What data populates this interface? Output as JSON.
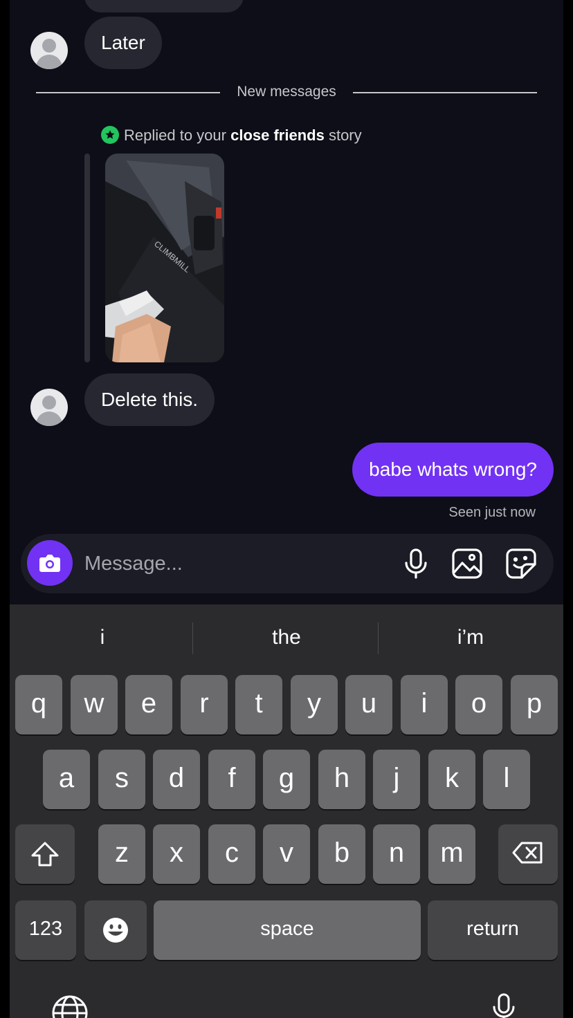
{
  "thread": {
    "messages": [
      {
        "text": "Later",
        "direction": "incoming"
      },
      {
        "text": "Delete this.",
        "direction": "incoming"
      },
      {
        "text": "babe whats wrong?",
        "direction": "outgoing"
      }
    ],
    "new_messages_label": "New messages",
    "story_reply": {
      "prefix": "Replied to your",
      "bold": "close friends",
      "suffix": "story",
      "badge_icon": "star-icon"
    },
    "seen_status": "Seen just now"
  },
  "composer": {
    "placeholder": "Message...",
    "icons": [
      "camera-icon",
      "microphone-icon",
      "gallery-icon",
      "sticker-icon"
    ],
    "accent_color": "#7232f3"
  },
  "keyboard": {
    "suggestions": [
      "i",
      "the",
      "i’m"
    ],
    "rows": [
      [
        "q",
        "w",
        "e",
        "r",
        "t",
        "y",
        "u",
        "i",
        "o",
        "p"
      ],
      [
        "a",
        "s",
        "d",
        "f",
        "g",
        "h",
        "j",
        "k",
        "l"
      ],
      [
        "z",
        "x",
        "c",
        "v",
        "b",
        "n",
        "m"
      ]
    ],
    "numbers_label": "123",
    "space_label": "space",
    "return_label": "return",
    "icons": [
      "shift-icon",
      "backspace-icon",
      "emoji-icon",
      "globe-icon",
      "dictation-icon"
    ]
  }
}
